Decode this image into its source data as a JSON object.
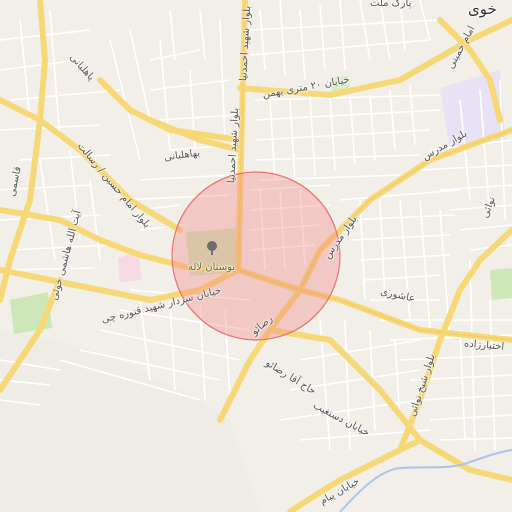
{
  "map": {
    "highlight_color": "#f08080",
    "labels": {
      "district_top_right": "خوی",
      "park_label": "بوستان لاله",
      "road_bahman": "خیابان ۲۰ متری بهمن",
      "road_ahmadinia": "بلوار شهید احمدنیا",
      "road_modarres": "بلوار مدرس",
      "road_modarres_2": "بلوار مدرس",
      "road_ashouri": "عاشوری",
      "road_emam_khomeini": "امام خمینی",
      "road_emam_hossein": "بلوار امام حسین / رسالت",
      "road_hashemi": "آیت الله هاشمی خوئی",
      "road_sardar": "خیابان سردار شهید قنوره چی",
      "road_reza": "رضائو",
      "road_haj_agha_reza": "حاج آقا رضائو",
      "road_dastgheib": "خیابان دستغیب",
      "road_sheikh_nowaei": "بلوار شیخ نوائی",
      "road_nowaei_top": "نوائی",
      "road_ghasemi": "قاسمی",
      "road_pahleban": "پاهلبانی",
      "road_bahaalbani": "بهاهلبانی",
      "road_ekhtiarzadeh": "اختیارزاده",
      "road_bottom": "خیابان پیام",
      "road_top_partial": "پارک ملت"
    }
  }
}
